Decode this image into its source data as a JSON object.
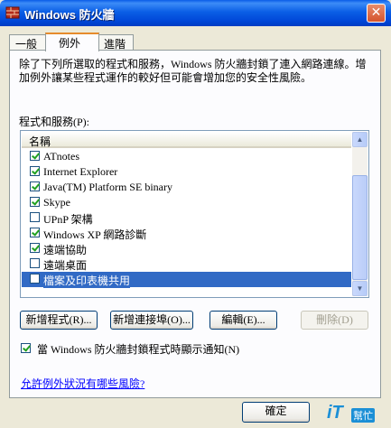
{
  "window": {
    "title": "Windows 防火牆",
    "close_glyph": "✕"
  },
  "tabs": [
    {
      "label": "一般"
    },
    {
      "label": "例外"
    },
    {
      "label": "進階"
    }
  ],
  "description": "除了下列所選取的程式和服務，Windows 防火牆封鎖了連入網路連線。增加例外讓某些程式運作的較好但可能會增加您的安全性風險。",
  "list": {
    "label": "程式和服務(P):",
    "column_header": "名稱",
    "items": [
      {
        "label": "ATnotes",
        "checked": true
      },
      {
        "label": "Internet Explorer",
        "checked": true
      },
      {
        "label": "Java(TM) Platform SE binary",
        "checked": true
      },
      {
        "label": "Skype",
        "checked": true
      },
      {
        "label": "UPnP 架構",
        "checked": false
      },
      {
        "label": "Windows XP 網路診斷",
        "checked": true
      },
      {
        "label": "遠端協助",
        "checked": true
      },
      {
        "label": "遠端桌面",
        "checked": false
      },
      {
        "label": "檔案及印表機共用",
        "checked": false,
        "selected": true
      }
    ]
  },
  "buttons": {
    "add_program": "新增程式(R)...",
    "add_port": "新增連接埠(O)...",
    "edit": "編輯(E)...",
    "delete": "刪除(D)"
  },
  "notify": {
    "label": "當 Windows 防火牆封鎖程式時顯示通知(N)",
    "checked": true
  },
  "risk_link": "允許例外狀況有哪些風險?",
  "ok_button": "確定",
  "watermark": {
    "brand": "iT",
    "sub": "幫忙"
  },
  "colors": {
    "title_bar": "#0b5fe6",
    "selection": "#316ac5",
    "dialog_bg": "#ece9d8"
  }
}
